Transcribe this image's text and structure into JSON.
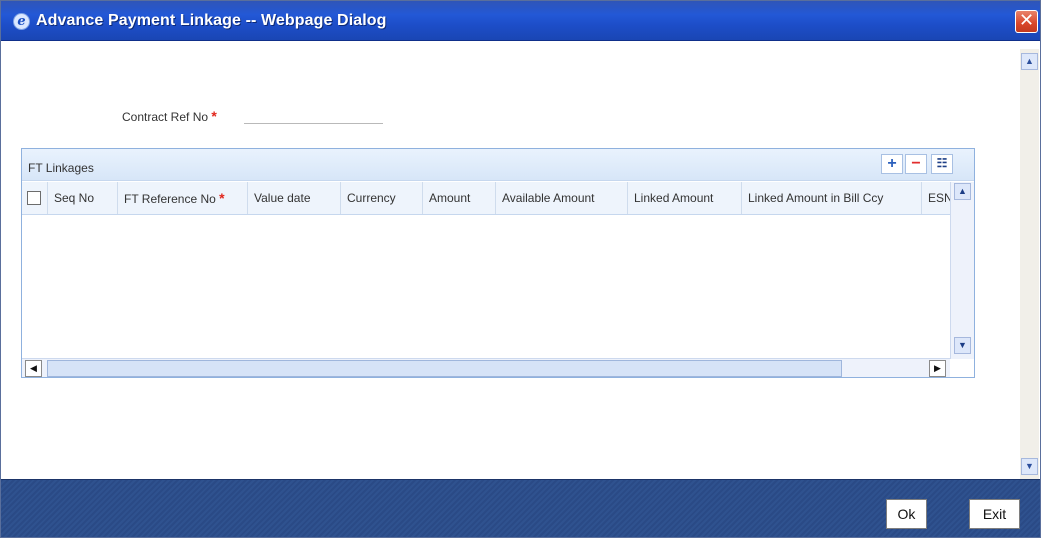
{
  "window": {
    "title": "Advance Payment Linkage -- Webpage Dialog",
    "close_symbol": "✕",
    "icon_letter": "e"
  },
  "form": {
    "contract_ref_label": "Contract Ref No",
    "required_mark": "*",
    "contract_ref_value": ""
  },
  "ft_linkages": {
    "title": "FT Linkages",
    "tools": {
      "add": "+",
      "delete": "−",
      "columns": "☷"
    },
    "columns": [
      "Seq No",
      "FT Reference No",
      "Value date",
      "Currency",
      "Amount",
      "Available Amount",
      "Linked Amount",
      "Linked Amount in Bill Ccy",
      "ESN"
    ],
    "rows": []
  },
  "scroll": {
    "up": "▲",
    "down": "▼",
    "left": "◀",
    "right": "▶"
  },
  "footer": {
    "ok_label": "Ok",
    "exit_label": "Exit"
  }
}
